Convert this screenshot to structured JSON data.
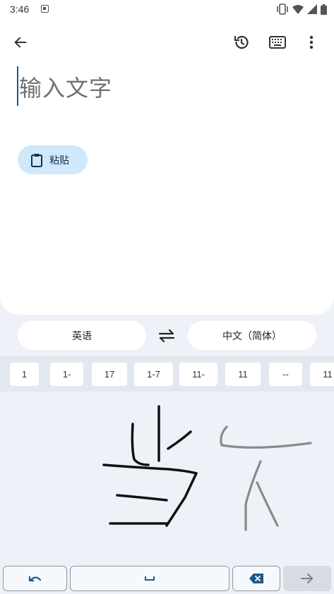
{
  "status": {
    "time": "3:46"
  },
  "input": {
    "placeholder": "输入文字"
  },
  "paste": {
    "label": "粘贴"
  },
  "languages": {
    "source": "英语",
    "target": "中文（简体）"
  },
  "suggestions": [
    "1",
    "1-",
    "17",
    "1-7",
    "11-",
    "11",
    "--",
    "11"
  ],
  "icons": {
    "back": "arrow-left-icon",
    "history": "history-icon",
    "keyboard": "keyboard-icon",
    "more": "more-vert-icon",
    "paste": "clipboard-icon",
    "swap": "swap-icon",
    "undo": "undo-icon",
    "space": "space-icon",
    "delete": "backspace-icon",
    "enter": "arrow-right-icon"
  },
  "colors": {
    "accent": "#cfe8fb",
    "cursor": "#1b5a8d",
    "background": "#eef1f7"
  }
}
